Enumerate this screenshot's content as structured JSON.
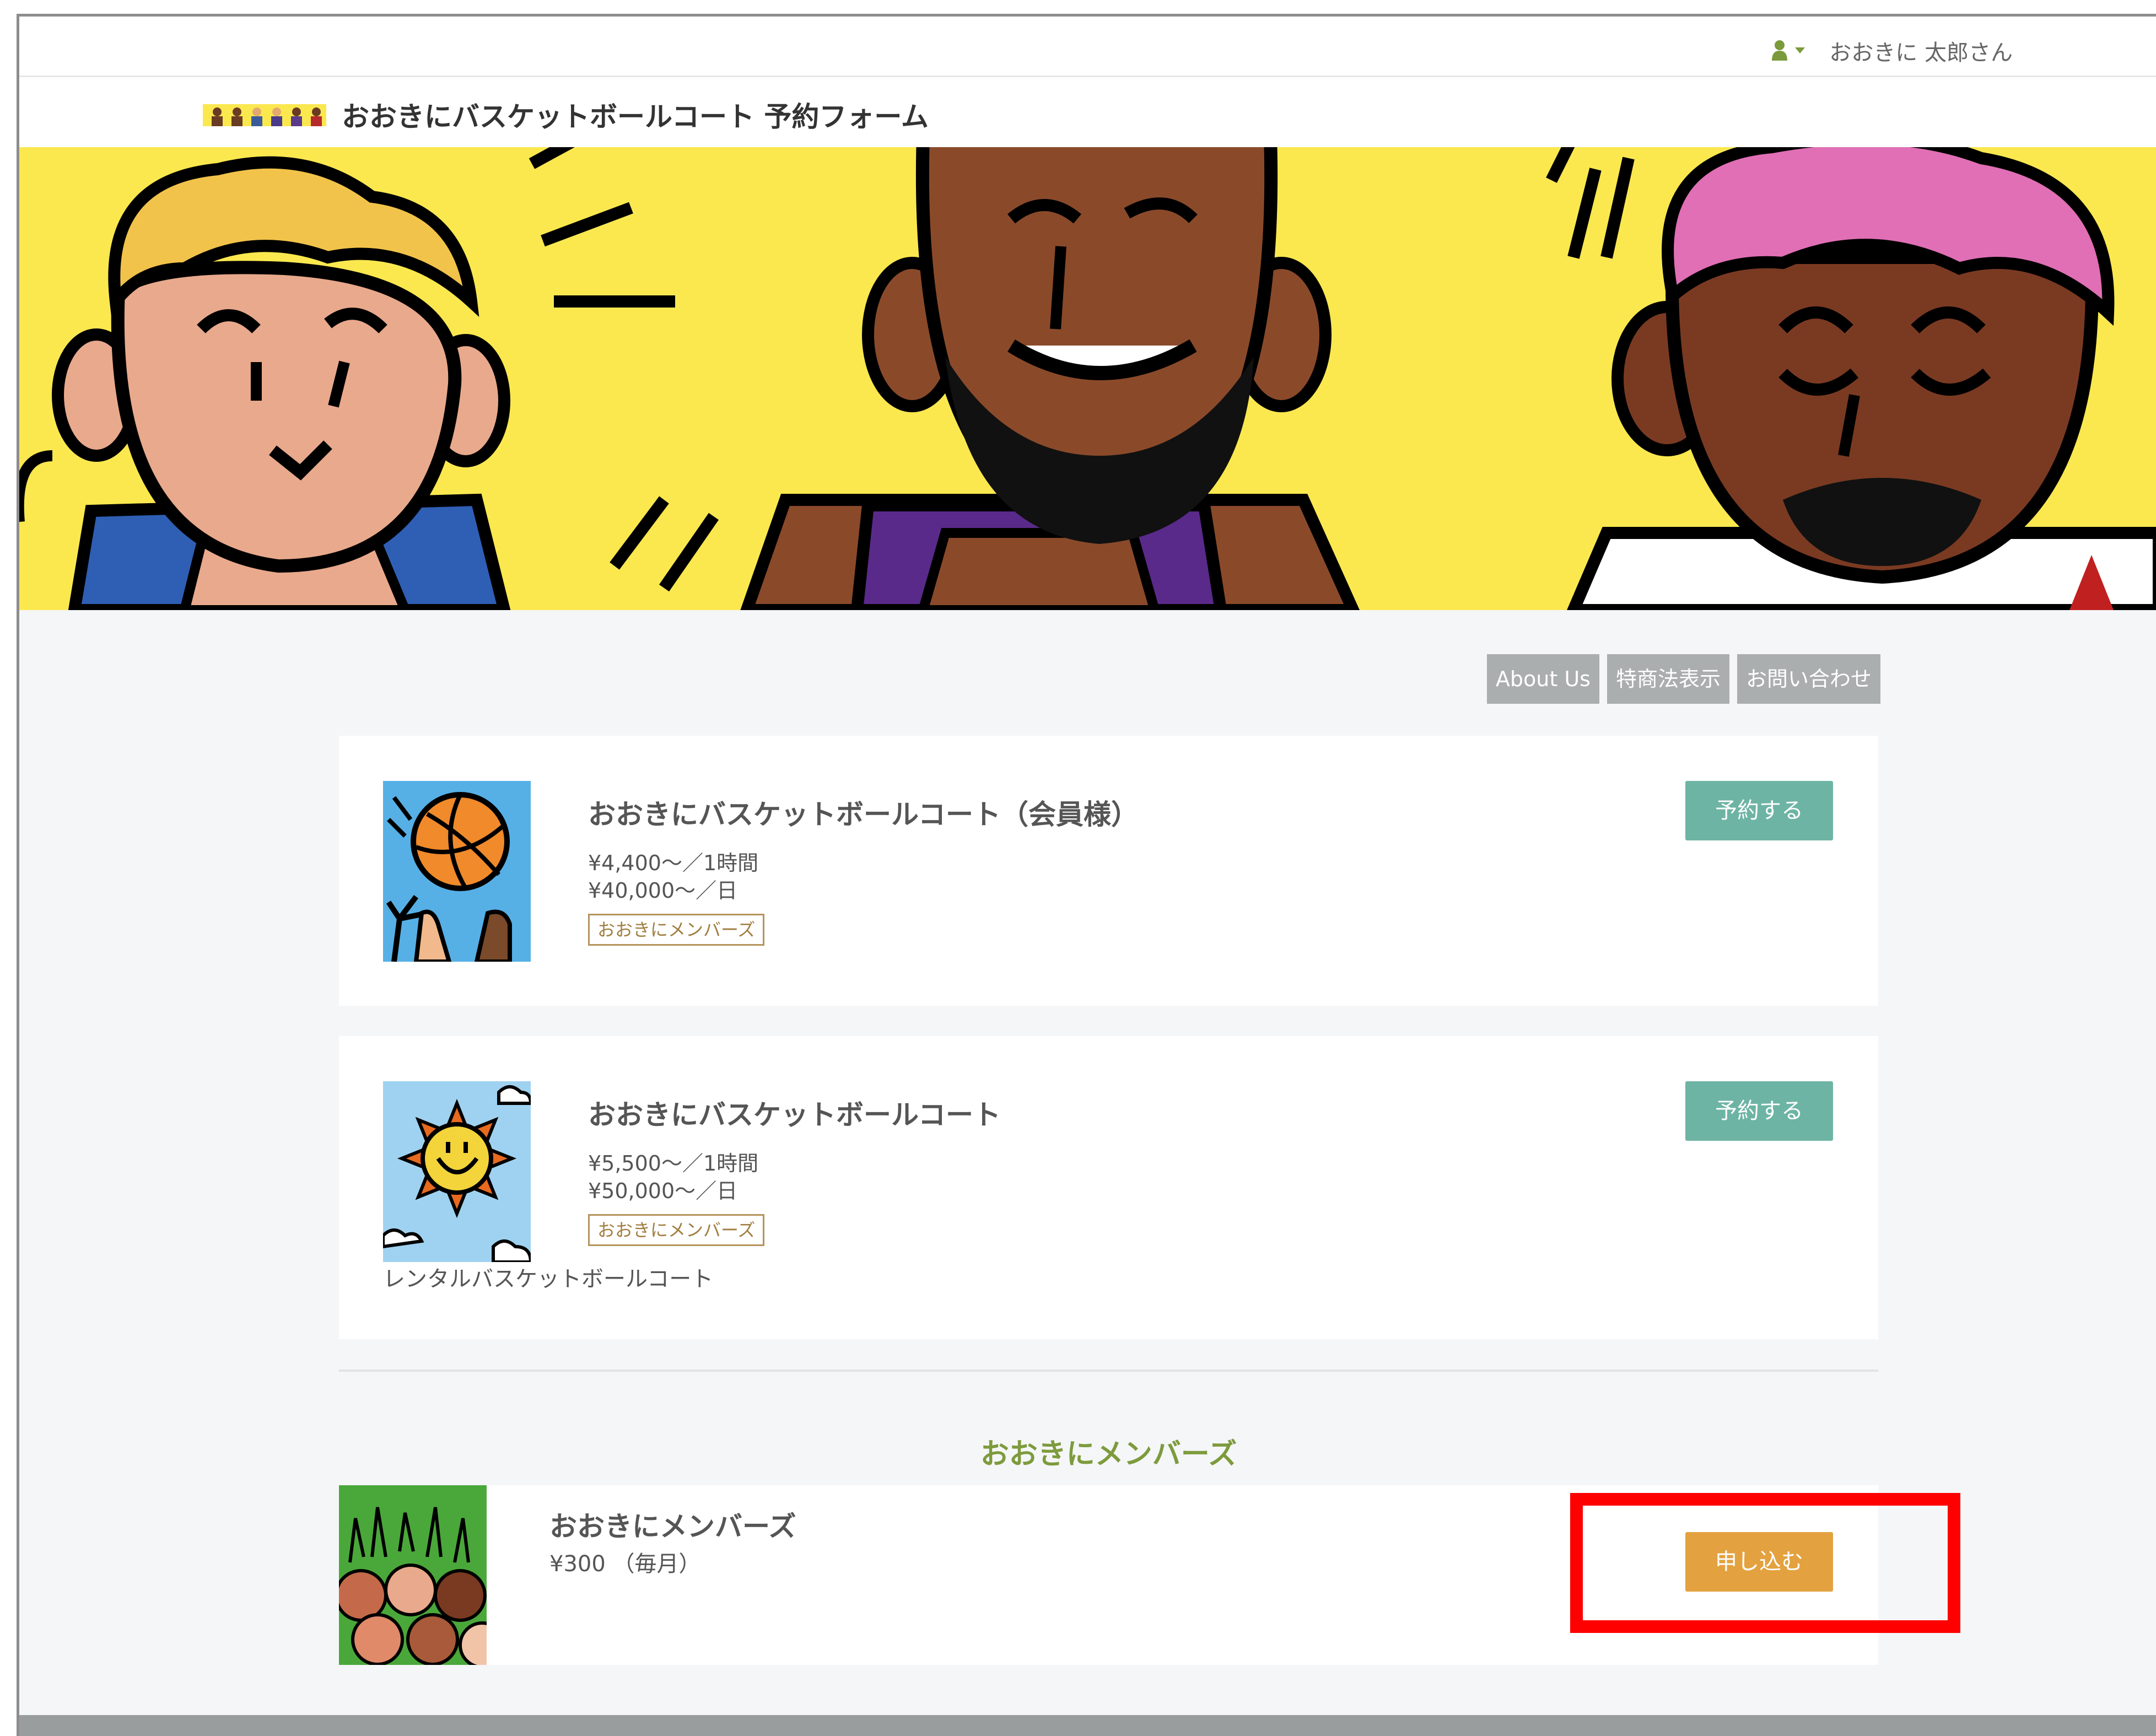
{
  "user": {
    "name": "おおきに 太郎さん",
    "icon": "user-icon"
  },
  "header": {
    "title": "おおきにバスケットボールコート 予約フォーム"
  },
  "nav": {
    "items": [
      "About Us",
      "特商法表示",
      "お問い合わせ"
    ]
  },
  "products": [
    {
      "title": "おおきにバスケットボールコート（会員様）",
      "price_hour": "¥4,400〜／1時間",
      "price_day": "¥40,000〜／日",
      "tag": "おおきにメンバーズ",
      "button": "予約する",
      "description": ""
    },
    {
      "title": "おおきにバスケットボールコート",
      "price_hour": "¥5,500〜／1時間",
      "price_day": "¥50,000〜／日",
      "tag": "おおきにメンバーズ",
      "button": "予約する",
      "description": "レンタルバスケットボールコート"
    }
  ],
  "membership": {
    "section_title": "おおきにメンバーズ",
    "title": "おおきにメンバーズ",
    "price": "¥300 （毎月）",
    "button": "申し込む"
  },
  "colors": {
    "reserve_button": "#6db4a4",
    "apply_button": "#e3a23f",
    "section_title": "#7d9b3c",
    "highlight": "#ff0000",
    "hero_background": "#fbe84f"
  }
}
